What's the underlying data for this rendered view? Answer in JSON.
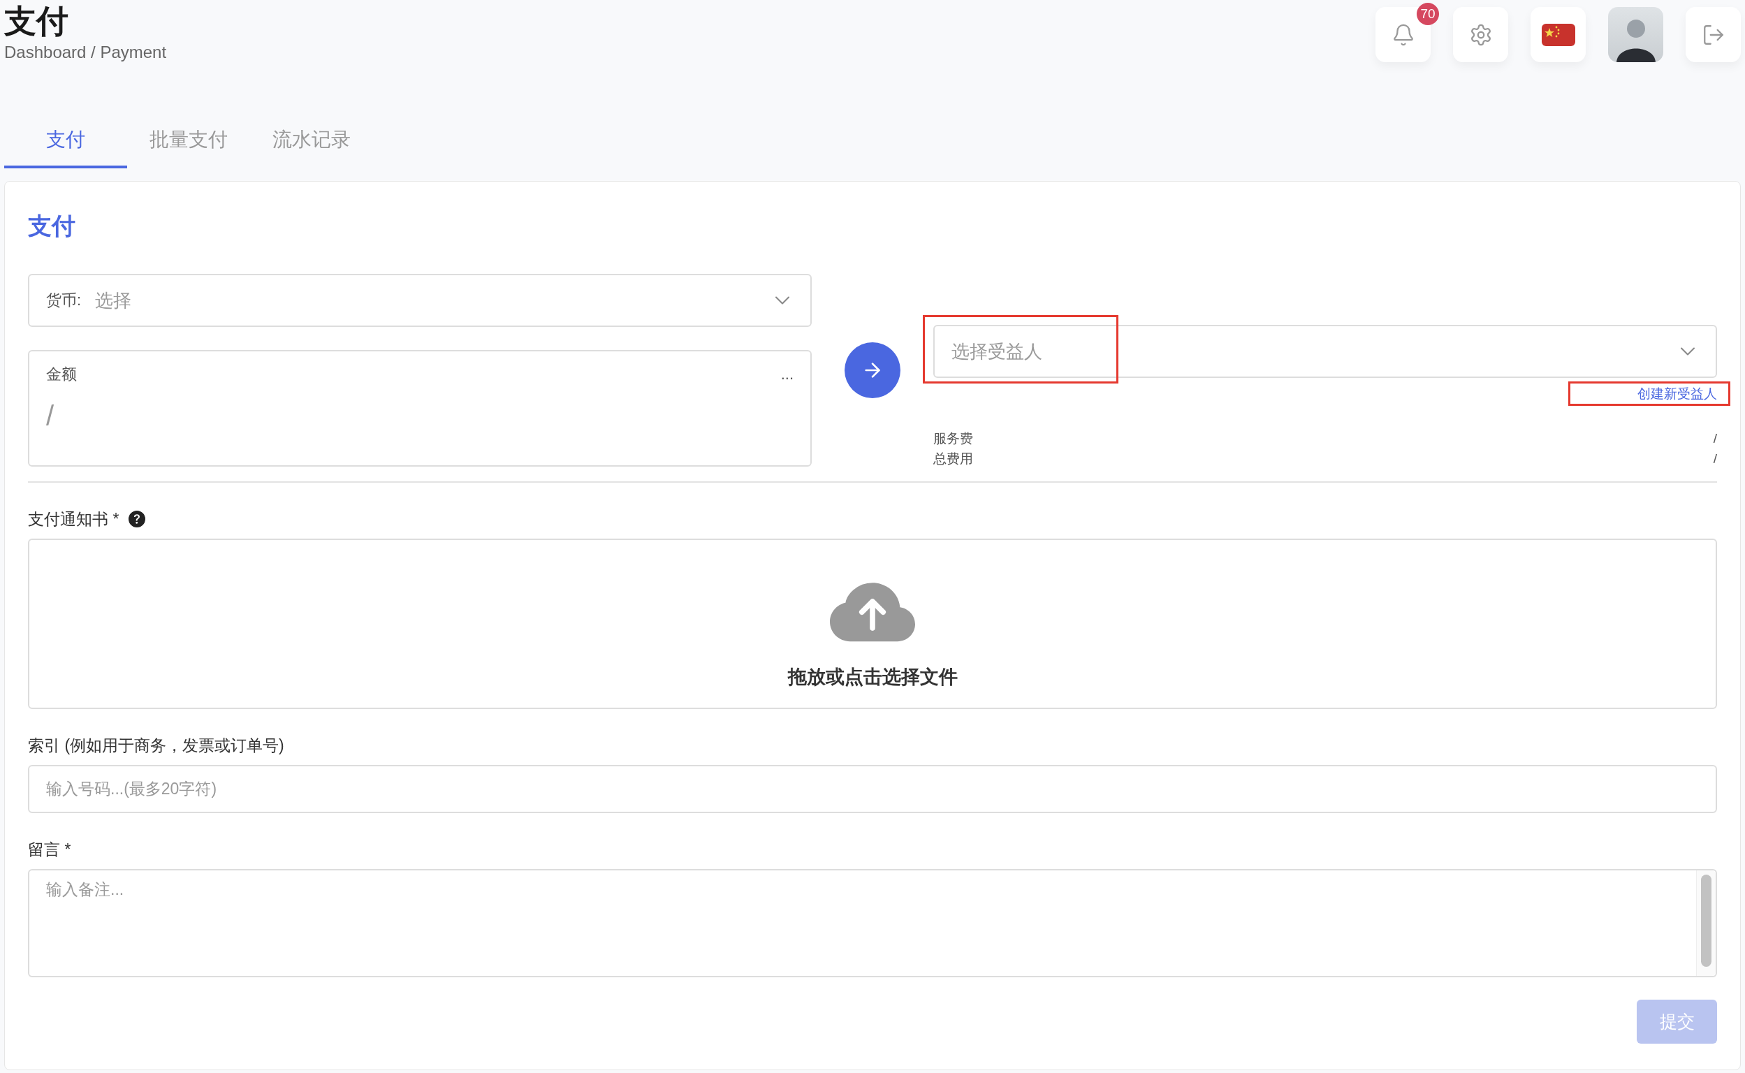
{
  "header": {
    "title": "支付",
    "breadcrumb": "Dashboard / Payment",
    "notification_count": "70"
  },
  "tabs": [
    {
      "label": "支付",
      "selected": true
    },
    {
      "label": "批量支付",
      "selected": false
    },
    {
      "label": "流水记录",
      "selected": false
    }
  ],
  "card": {
    "title": "支付"
  },
  "currency": {
    "label": "货币:",
    "placeholder": "选择"
  },
  "amount": {
    "label": "金额",
    "menu": "...",
    "placeholder": "/"
  },
  "beneficiary": {
    "placeholder": "选择受益人",
    "highlighted": true
  },
  "create_beneficiary": {
    "label": "创建新受益人",
    "highlighted": true
  },
  "fees": [
    {
      "label": "服务费",
      "value": "/"
    },
    {
      "label": "总费用",
      "value": "/"
    }
  ],
  "payment_notice": {
    "label": "支付通知书 *",
    "upload_text": "拖放或点击选择文件"
  },
  "reference": {
    "label": "索引 (例如用于商务，发票或订单号)",
    "placeholder": "输入号码...(最多20字符)"
  },
  "message": {
    "label": "留言 *",
    "placeholder": "输入备注..."
  },
  "submit": {
    "label": "提交",
    "disabled": true
  }
}
